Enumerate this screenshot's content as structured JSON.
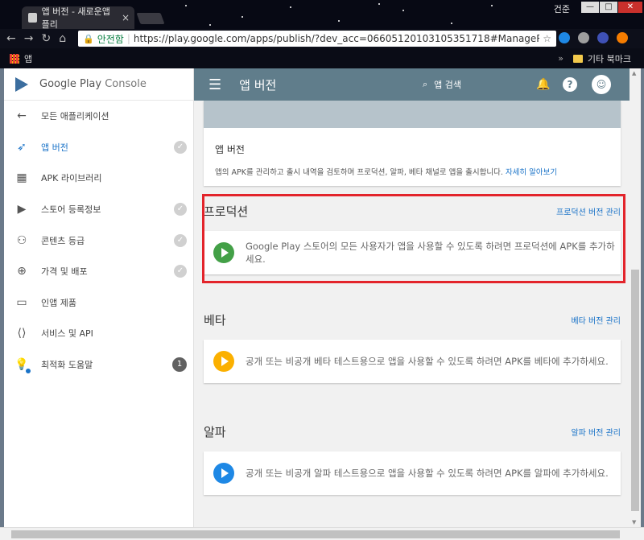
{
  "browser": {
    "tab_title": "앱 버전 - 새로운앱플리",
    "tab_close": "×",
    "window_user": "건준",
    "win_min": "—",
    "win_max": "□",
    "win_close": "✕",
    "secure_label": "안전함",
    "url": "https://play.google.com/apps/publish/?dev_acc=06605120103105351718#ManageReleasesPlace:p=t",
    "bookmarks_apps_label": "앱",
    "bookmarks_more": "»",
    "bookmarks_other": "기타 북마크"
  },
  "sidebar": {
    "brand": "Google Play",
    "brand_suffix": "Console",
    "items": [
      {
        "label": "모든 애플리케이션",
        "icon": "back-arrow-icon",
        "glyph": "←"
      },
      {
        "label": "앱 버전",
        "icon": "rocket-icon",
        "glyph": "🚀",
        "check": "✓"
      },
      {
        "label": "APK 라이브러리",
        "icon": "grid-icon",
        "glyph": "▦"
      },
      {
        "label": "스토어 등록정보",
        "icon": "store-icon",
        "glyph": "▶",
        "check": "✓"
      },
      {
        "label": "콘텐츠 등급",
        "icon": "content-rating-icon",
        "glyph": "⚇",
        "check": "✓"
      },
      {
        "label": "가격 및 배포",
        "icon": "globe-icon",
        "glyph": "⊕",
        "check": "✓"
      },
      {
        "label": "인앱 제품",
        "icon": "card-icon",
        "glyph": "▭"
      },
      {
        "label": "서비스 및 API",
        "icon": "code-icon",
        "glyph": "⟨⟩"
      },
      {
        "label": "최적화 도움말",
        "icon": "bulb-icon",
        "glyph": "♀",
        "count": "1"
      }
    ]
  },
  "topbar": {
    "menu_glyph": "☰",
    "title": "앱 버전",
    "search_glyph": "🔍",
    "search_label": "앱 검색",
    "bell_glyph": "🔔",
    "help_glyph": "?",
    "avatar_glyph": "☺"
  },
  "app_versions_card": {
    "title": "앱 버전",
    "description": "앱의 APK를 관리하고 출시 내역을 검토하며 프로덕션, 알파, 베타 채널로 앱을 출시합니다.",
    "learn_more": "자세히 알아보기"
  },
  "sections": [
    {
      "title": "프로덕션",
      "link": "프로덕션 버전 관리",
      "message": "Google Play 스토어의 모든 사용자가 앱을 사용할 수 있도록 하려면 프로덕션에 APK를 추가하세요.",
      "color": "#43a047"
    },
    {
      "title": "베타",
      "link": "베타 버전 관리",
      "message": "공개 또는 비공개 베타 테스트용으로 앱을 사용할 수 있도록 하려면 APK를 베타에 추가하세요.",
      "color": "#fbb000"
    },
    {
      "title": "알파",
      "link": "알파 버전 관리",
      "message": "공개 또는 비공개 알파 테스트용으로 앱을 사용할 수 있도록 하려면 APK를 알파에 추가하세요.",
      "color": "#1e88e5"
    }
  ],
  "colors": {
    "accent": "#1a73c8",
    "toolbar": "#607d8b",
    "highlight": "#e3242b"
  }
}
